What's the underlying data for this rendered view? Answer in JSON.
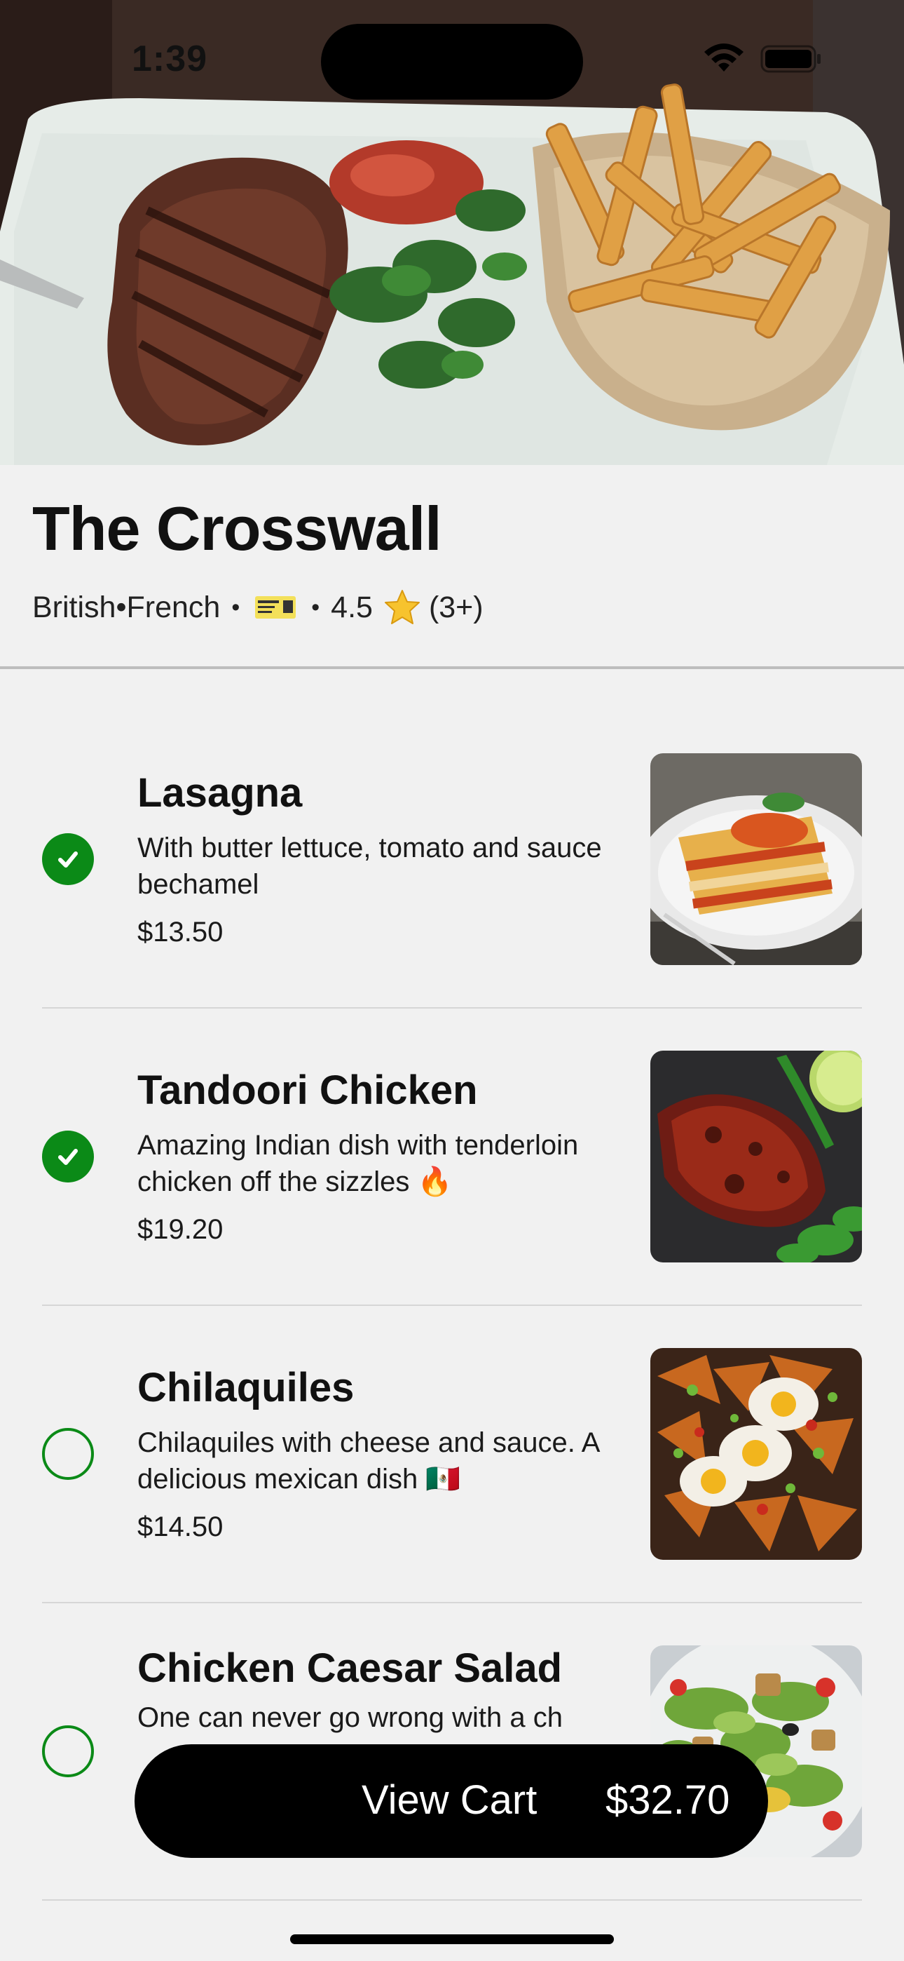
{
  "status_bar": {
    "time": "1:39",
    "wifi_icon": "wifi-icon",
    "battery_icon": "battery-icon"
  },
  "restaurant": {
    "name": "The Crosswall",
    "cuisine": "British•French",
    "separator": "•",
    "ticket_icon": "ticket-icon",
    "rating": "4.5",
    "rating_icon": "star-icon",
    "reviews": "(3+)"
  },
  "menu": {
    "items": [
      {
        "title": "Lasagna",
        "description": "With butter lettuce, tomato and sauce bechamel",
        "price": "$13.50",
        "selected": true,
        "thumbnail": "lasagna-photo"
      },
      {
        "title": "Tandoori Chicken",
        "description": "Amazing Indian dish with tenderloin chicken off the sizzles 🔥",
        "price": "$19.20",
        "selected": true,
        "thumbnail": "tandoori-chicken-photo"
      },
      {
        "title": "Chilaquiles",
        "description": "Chilaquiles with cheese and sauce. A delicious mexican dish 🇲🇽",
        "price": "$14.50",
        "selected": false,
        "thumbnail": "chilaquiles-photo"
      },
      {
        "title": "Chicken Caesar Salad",
        "description": "One can never go wrong with a ch",
        "price": "$",
        "selected": false,
        "thumbnail": "caesar-salad-photo"
      }
    ]
  },
  "cart": {
    "label": "View Cart",
    "total": "$32.70"
  },
  "colors": {
    "accent_green": "#0b8a17",
    "background": "#f1f1f1",
    "cart_button": "#000000"
  }
}
